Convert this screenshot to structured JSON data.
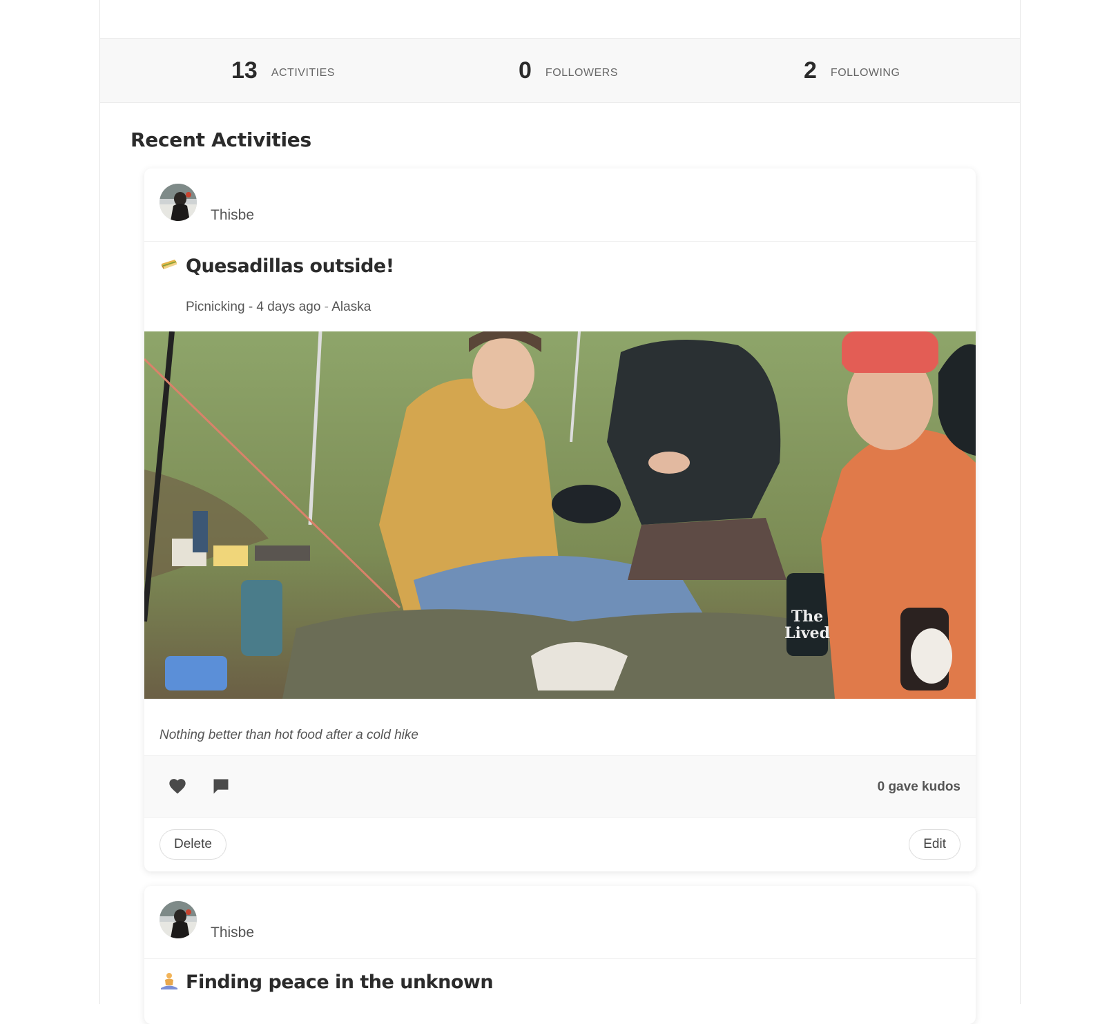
{
  "stats": [
    {
      "value": "13",
      "label": "ACTIVITIES"
    },
    {
      "value": "0",
      "label": "FOLLOWERS"
    },
    {
      "value": "2",
      "label": "FOLLOWING"
    }
  ],
  "recent_title": "Recent Activities",
  "activities": [
    {
      "user": "Thisbe",
      "emoji_icon": "sandwich-icon",
      "title": "Quesadillas outside!",
      "meta_type": "Picnicking - 4 days ago",
      "meta_sep": " - ",
      "meta_location": "Alaska",
      "caption": "Nothing better than hot food after a cold hike",
      "kudos": "0 gave kudos",
      "delete_label": "Delete",
      "edit_label": "Edit"
    },
    {
      "user": "Thisbe",
      "emoji_icon": "meditation-icon",
      "title": "Finding peace in the unknown"
    }
  ],
  "colors": {
    "stats_bg": "#f8f8f8",
    "text_dark": "#2b2b2b",
    "text_muted": "#555555"
  }
}
